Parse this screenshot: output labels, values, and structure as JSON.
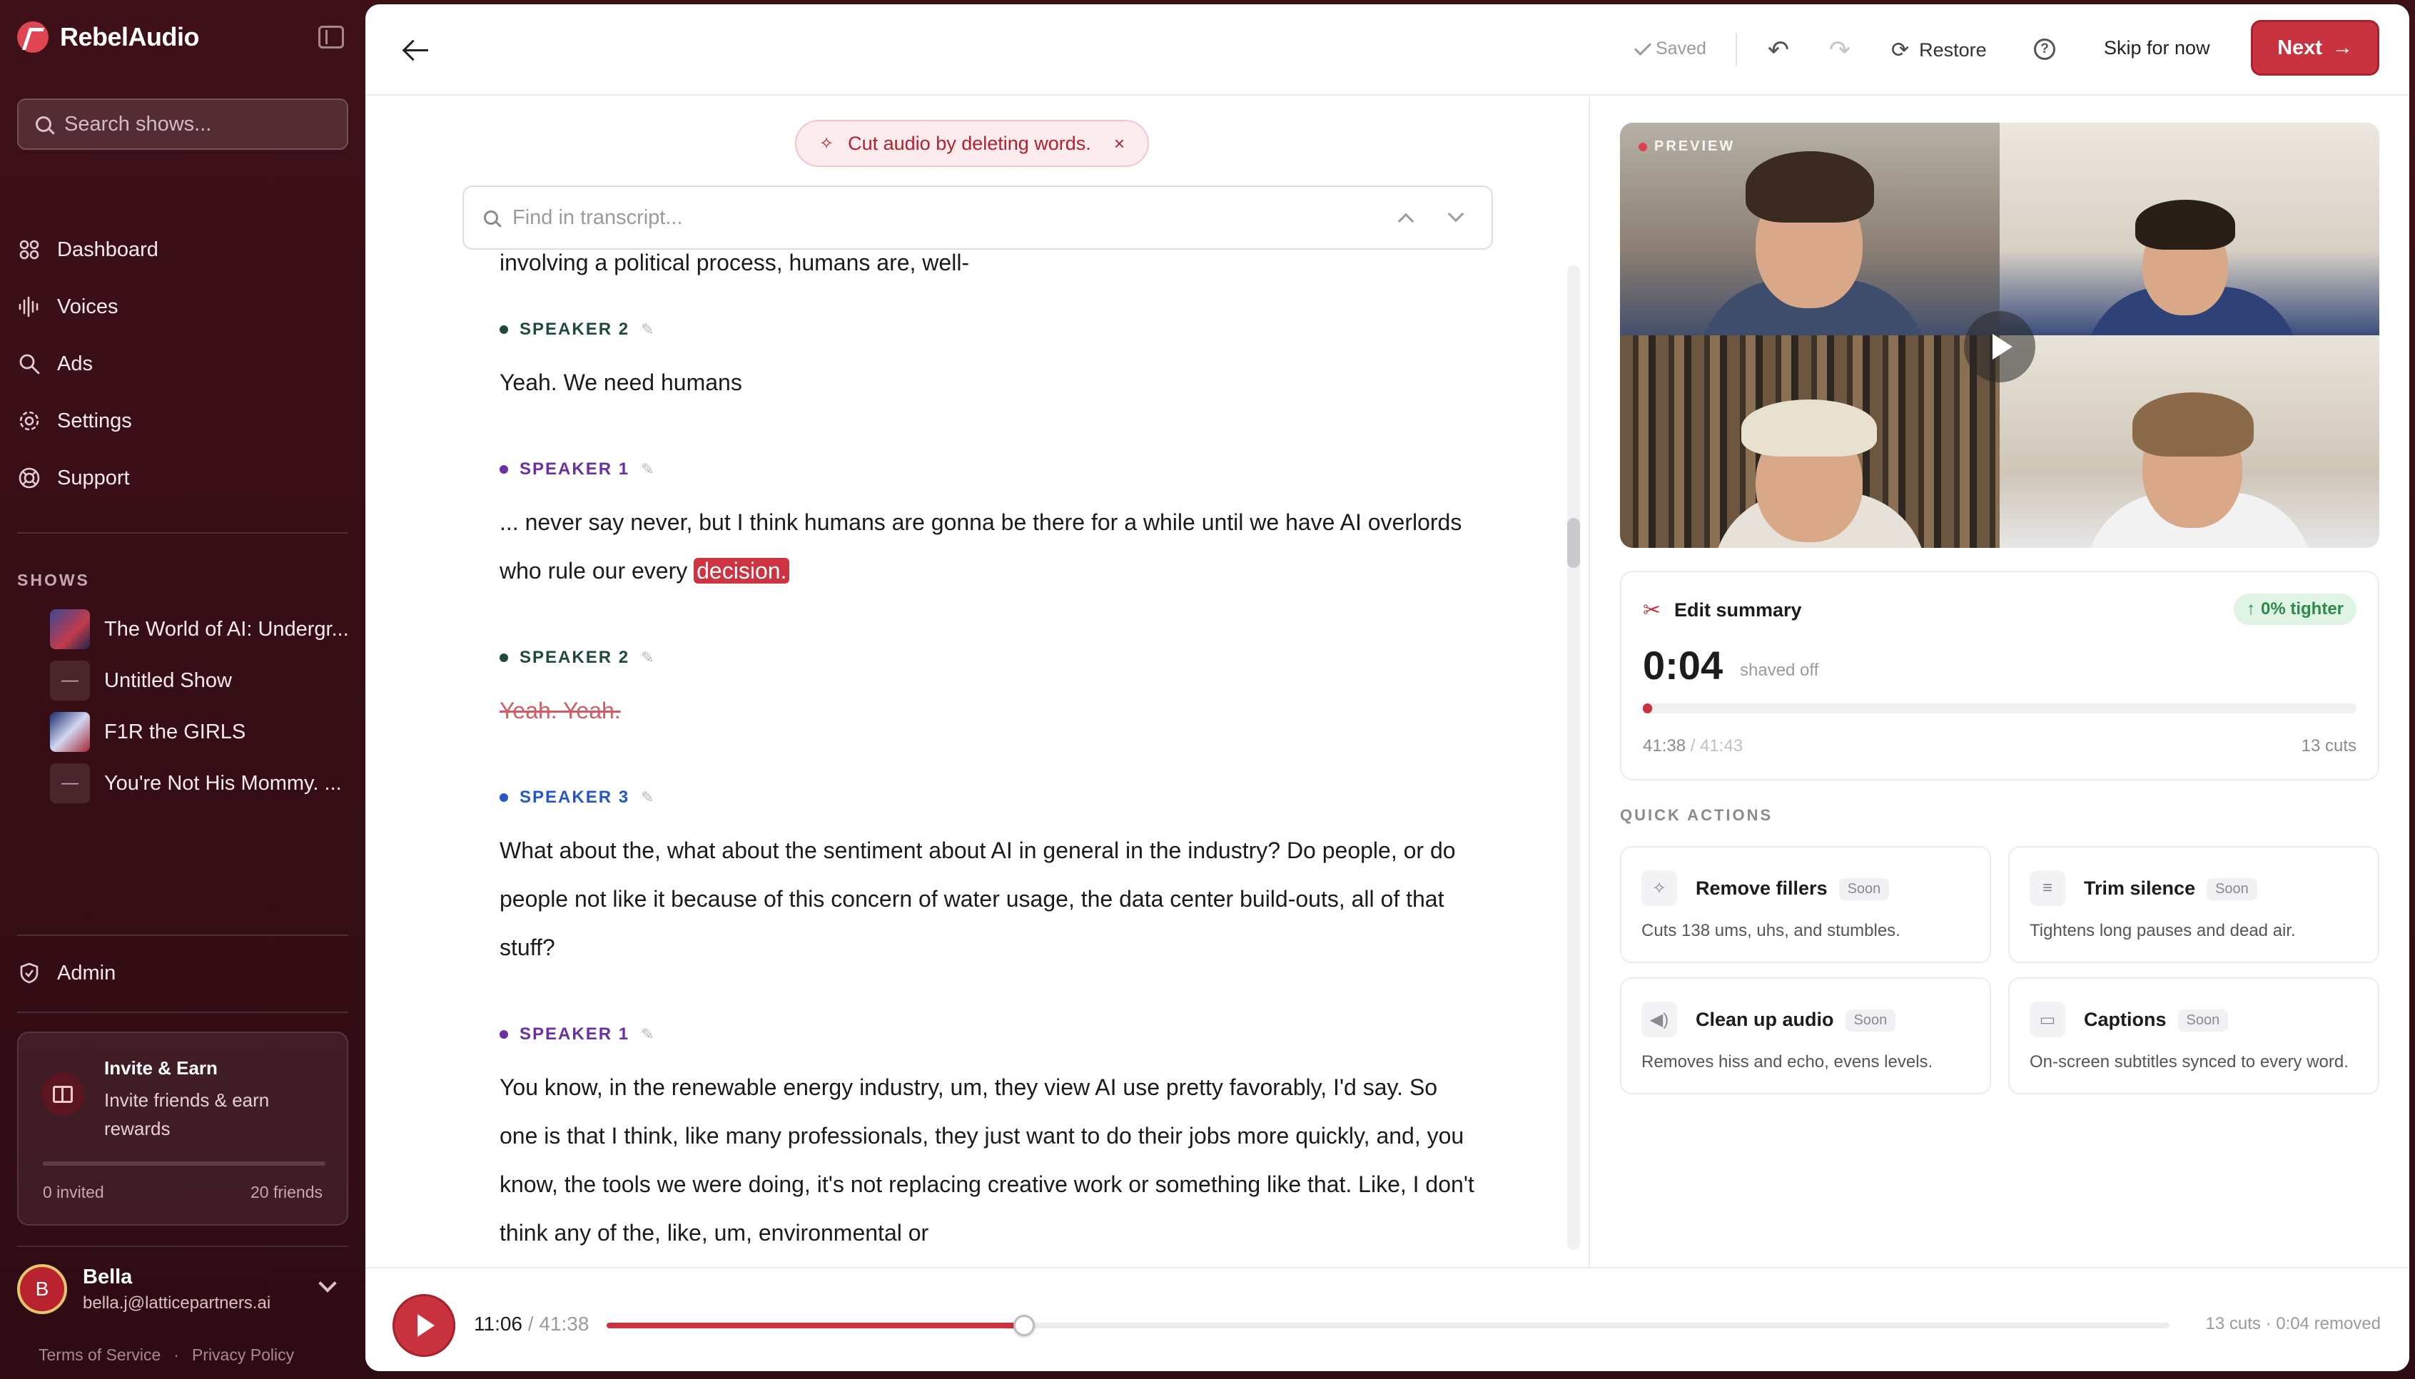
{
  "sidebar": {
    "brand": "RebelAudio",
    "search_placeholder": "Search shows...",
    "nav": [
      {
        "label": "Dashboard",
        "icon": "dashboard-icon"
      },
      {
        "label": "Voices",
        "icon": "waveform-icon"
      },
      {
        "label": "Ads",
        "icon": "search-icon"
      },
      {
        "label": "Settings",
        "icon": "gear-icon"
      },
      {
        "label": "Support",
        "icon": "lifebuoy-icon"
      }
    ],
    "shows_label": "SHOWS",
    "shows": [
      {
        "label": "The World of AI: Undergr..."
      },
      {
        "label": "Untitled Show",
        "placeholder": "—"
      },
      {
        "label": "F1R the GIRLS"
      },
      {
        "label": "You're Not His Mommy. ...",
        "placeholder": "—"
      }
    ],
    "admin_label": "Admin",
    "invite": {
      "title": "Invite & Earn",
      "desc": "Invite friends & earn rewards",
      "invited": "0 invited",
      "goal": "20 friends",
      "progress": 0
    },
    "user": {
      "initial": "B",
      "name": "Bella",
      "email": "bella.j@latticepartners.ai"
    },
    "legal": {
      "terms": "Terms of Service",
      "sep": "·",
      "privacy": "Privacy Policy"
    }
  },
  "topbar": {
    "saved": "Saved",
    "restore": "Restore",
    "help": "?",
    "skip": "Skip for now",
    "next": "Next",
    "next_arrow": "→"
  },
  "transcript": {
    "hint": "Cut audio by deleting words.",
    "hint_close": "×",
    "find_placeholder": "Find in transcript...",
    "line0": "involving a political process, humans are, well-",
    "blocks": [
      {
        "speaker": "SPEAKER 2",
        "text": "Yeah. We need humans"
      },
      {
        "speaker": "SPEAKER 1",
        "text": "... never say never, but I think humans are gonna be there for a while until we have AI overlords who rule our every",
        "highlight": "decision."
      },
      {
        "speaker": "SPEAKER 2",
        "text": "Yeah. Yeah."
      },
      {
        "speaker": "SPEAKER 3",
        "text": "What about the, what about the sentiment about AI in general in the industry? Do people, or do people not like it because of this concern of water usage, the data center build-outs, all of that stuff?"
      },
      {
        "speaker": "SPEAKER 1",
        "text": "You know, in the renewable energy industry, um, they view AI use pretty favorably, I'd say. So one is that I think, like many professionals, they just want to do their jobs more quickly, and, you know, the tools we were doing, it's not replacing creative work or something like that. Like, I don't think any of the, like, um, environmental or"
      }
    ]
  },
  "preview": {
    "label": "PREVIEW"
  },
  "summary": {
    "title": "Edit summary",
    "tighter": "0% tighter",
    "tighter_arrow": "↑",
    "shaved": "0:04",
    "shaved_label": "shaved off",
    "time_current": "41:38",
    "time_sep": " / ",
    "time_original": "41:43",
    "cuts": "13 cuts",
    "progress": 0.013
  },
  "quick_actions": {
    "label": "QUICK ACTIONS",
    "soon": "Soon",
    "items": [
      {
        "title": "Remove fillers",
        "desc": "Cuts 138 ums, uhs, and stumbles.",
        "icon": "sparkle-icon"
      },
      {
        "title": "Trim silence",
        "desc": "Tightens long pauses and dead air.",
        "icon": "sliders-icon"
      },
      {
        "title": "Clean up audio",
        "desc": "Removes hiss and echo, evens levels.",
        "icon": "speaker-icon"
      },
      {
        "title": "Captions",
        "desc": "On-screen subtitles synced to every word.",
        "icon": "caption-icon"
      }
    ]
  },
  "player": {
    "current": "11:06",
    "sep": " / ",
    "duration": "41:38",
    "stats": "13 cuts · 0:04 removed",
    "progress": 0.267
  },
  "colors": {
    "accent": "#c8333f",
    "sidebar_bg": "#3e1018",
    "success": "#2e8a4a"
  }
}
